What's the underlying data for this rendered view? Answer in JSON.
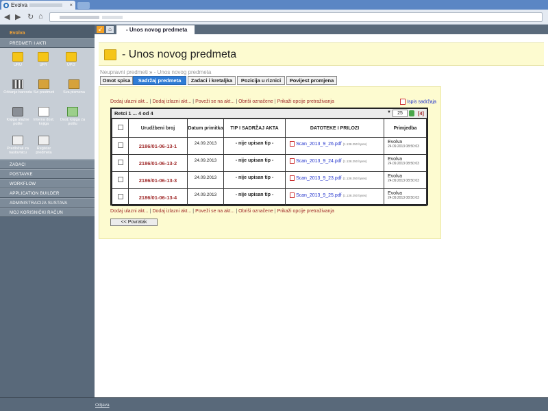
{
  "browser": {
    "tab_title": "Evolva",
    "tab_close": "×"
  },
  "app": {
    "brand": "Evolva",
    "section_title": "PREDMETI I AKTI",
    "grid_items": [
      {
        "label": "URU",
        "icon": "folder-icon"
      },
      {
        "label": "UP/I",
        "icon": "folder-icon"
      },
      {
        "label": "UP/2",
        "icon": "folder-icon"
      },
      {
        "label": "Očitanje barcoda",
        "icon": "barcode-icon"
      },
      {
        "label": "Svi predmeti",
        "icon": "drawer-icon"
      },
      {
        "label": "Sva pismena",
        "icon": "drawer-icon"
      },
      {
        "label": "Knjiga ulazne pošte",
        "icon": "printer-icon"
      },
      {
        "label": "Interna dost. knjiga",
        "icon": "document-icon"
      },
      {
        "label": "Dost. knjiga za poštu",
        "icon": "green-book-icon"
      },
      {
        "label": "Predložak za naslovnicu",
        "icon": "clipboard-icon"
      },
      {
        "label": "Registar predmeta",
        "icon": "clipboard-icon"
      }
    ],
    "menu": [
      "ZADACI",
      "POSTAVKE",
      "WORKFLOW",
      "APPLICATION BUILDER",
      "ADMINISTRACIJA SUSTAVA",
      "MOJ KORISNIČKI RAČUN"
    ],
    "footer_link": "Odjava"
  },
  "main": {
    "tab_label": "- Unos novog predmeta",
    "title": "- Unos novog predmeta",
    "breadcrumb": [
      "Neupravni predmeti",
      "»",
      "- Unos novog predmeta"
    ],
    "page_tabs": [
      {
        "label": "Omot spisa",
        "active": false
      },
      {
        "label": "Sadržaj predmeta",
        "active": true
      },
      {
        "label": "Zadaci i kretaljka",
        "active": false
      },
      {
        "label": "Pozicija u riznici",
        "active": false
      },
      {
        "label": "Povijest promjena",
        "active": false
      }
    ],
    "print_link": "Ispis sadržaja",
    "actions": [
      "Dodaj ulazni akt...",
      "Dodaj izlazni akt...",
      "Poveži se na akt...",
      "Obriši označene",
      "Prikaži opcije pretraživanja"
    ],
    "table": {
      "rows_info": "Retci 1 ... 4 od 4",
      "page_size": "25",
      "count": "[4]",
      "columns": [
        "Urudžbeni broj",
        "Datum primitka",
        "TIP I SADRŽAJ AKTA",
        "DATOTEKE I PRILOZI",
        "Primjedba"
      ],
      "rows": [
        {
          "broj": "2186/01-06-13-1",
          "datum": "24.09.2013",
          "tip": "- nije upisan tip -",
          "file": "Scan_2013_9_26.pdf",
          "size": "(1.138.250 bytes)",
          "who": "Evolva",
          "when": "24.09.2013 08:50:03"
        },
        {
          "broj": "2186/01-06-13-2",
          "datum": "24.09.2013",
          "tip": "- nije upisan tip -",
          "file": "Scan_2013_9_24.pdf",
          "size": "(1.138.250 bytes)",
          "who": "Evolva",
          "when": "24.09.2013 08:50:03"
        },
        {
          "broj": "2186/01-06-13-3",
          "datum": "24.09.2013",
          "tip": "- nije upisan tip -",
          "file": "Scan_2013_9_23.pdf",
          "size": "(1.138.250 bytes)",
          "who": "Evolva",
          "when": "24.09.2013 08:50:03"
        },
        {
          "broj": "2186/01-06-13-4",
          "datum": "24.09.2013",
          "tip": "- nije upisan tip -",
          "file": "Scan_2013_9_25.pdf",
          "size": "(1.138.250 bytes)",
          "who": "Evolva",
          "when": "24.09.2013 08:50:03"
        }
      ]
    },
    "back_button": "<< Povratak"
  }
}
